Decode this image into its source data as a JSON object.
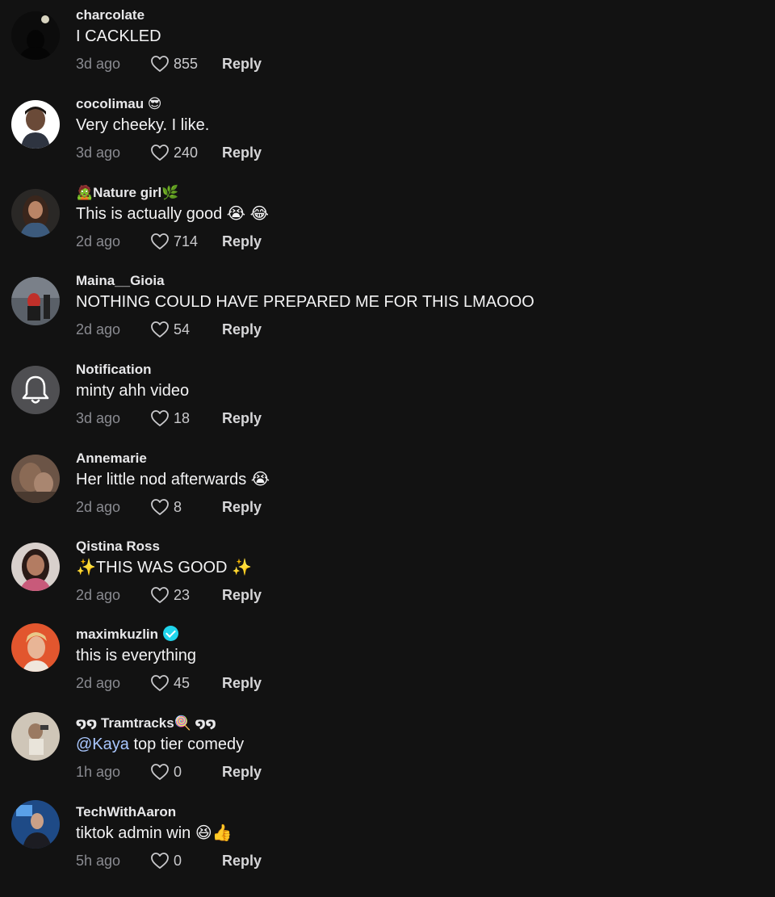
{
  "comments": [
    {
      "username": "charcolate",
      "text": "I CACKLED",
      "time": "3d ago",
      "likes": "855",
      "reply_label": "Reply"
    },
    {
      "username": "cocolimau 😎",
      "text": "Very cheeky. I like.",
      "time": "3d ago",
      "likes": "240",
      "reply_label": "Reply"
    },
    {
      "username": "🧟Nature girl🌿",
      "text": "This is actually good 😭 😂",
      "time": "2d ago",
      "likes": "714",
      "reply_label": "Reply"
    },
    {
      "username": "Maina__Gioia",
      "text": "NOTHING COULD HAVE PREPARED ME FOR THIS LMAOOO",
      "time": "2d ago",
      "likes": "54",
      "reply_label": "Reply"
    },
    {
      "username": "Notification",
      "text": "minty ahh video",
      "time": "3d ago",
      "likes": "18",
      "reply_label": "Reply"
    },
    {
      "username": "Annemarie",
      "text": "Her little nod afterwards 😭",
      "time": "2d ago",
      "likes": "8",
      "reply_label": "Reply"
    },
    {
      "username": "Qistina Ross",
      "text": "✨THIS WAS GOOD ✨",
      "time": "2d ago",
      "likes": "23",
      "reply_label": "Reply"
    },
    {
      "username": "maximkuzlin",
      "text": "this is everything",
      "time": "2d ago",
      "likes": "45",
      "reply_label": "Reply"
    },
    {
      "username": "໑໑ Tramtracks🍭 ໑໑",
      "mention": "@Kaya",
      "text": " top tier comedy",
      "time": "1h ago",
      "likes": "0",
      "reply_label": "Reply"
    },
    {
      "username": "TechWithAaron",
      "text": "tiktok admin win 😆👍",
      "time": "5h ago",
      "likes": "0",
      "reply_label": "Reply"
    }
  ],
  "colors": {
    "background": "#121212",
    "username": "#e8e8ea",
    "comment_text": "#f3f3f4",
    "timestamp": "#8a8b91",
    "mention": "#a9c7ff",
    "verified_badge": "#20d5ec"
  },
  "icons": {
    "like": "heart-outline-icon",
    "notification_avatar": "bell-icon",
    "verified": "verified-badge-icon"
  }
}
